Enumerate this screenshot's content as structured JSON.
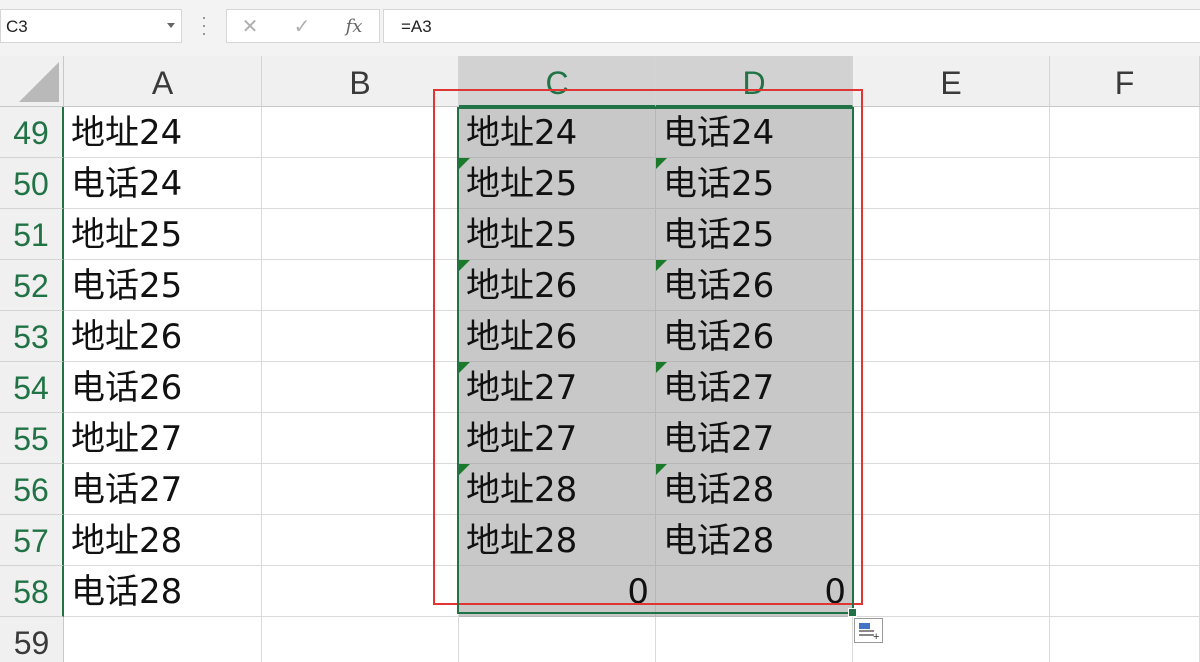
{
  "formula_bar": {
    "name_box": "C3",
    "cancel_symbol": "✕",
    "enter_symbol": "✓",
    "fx_symbol": "fx",
    "formula": "=A3"
  },
  "columns": [
    "A",
    "B",
    "C",
    "D",
    "E",
    "F"
  ],
  "rows": [
    {
      "num": "49",
      "A": "地址24",
      "C": "地址24",
      "D": "电话24",
      "tri": false
    },
    {
      "num": "50",
      "A": "电话24",
      "C": "地址25",
      "D": "电话25",
      "tri": true
    },
    {
      "num": "51",
      "A": "地址25",
      "C": "地址25",
      "D": "电话25",
      "tri": false
    },
    {
      "num": "52",
      "A": "电话25",
      "C": "地址26",
      "D": "电话26",
      "tri": true
    },
    {
      "num": "53",
      "A": "地址26",
      "C": "地址26",
      "D": "电话26",
      "tri": false
    },
    {
      "num": "54",
      "A": "电话26",
      "C": "地址27",
      "D": "电话27",
      "tri": true
    },
    {
      "num": "55",
      "A": "地址27",
      "C": "地址27",
      "D": "电话27",
      "tri": false
    },
    {
      "num": "56",
      "A": "电话27",
      "C": "地址28",
      "D": "电话28",
      "tri": true
    },
    {
      "num": "57",
      "A": "地址28",
      "C": "地址28",
      "D": "电话28",
      "tri": false
    },
    {
      "num": "58",
      "A": "电话28",
      "C": "0",
      "D": "0",
      "tri": false
    },
    {
      "num": "59",
      "A": "",
      "C": "",
      "D": "",
      "tri": false
    }
  ],
  "colors": {
    "accent": "#217346",
    "highlight_box": "#e03535",
    "selection_fill": "#c8c8c8"
  }
}
